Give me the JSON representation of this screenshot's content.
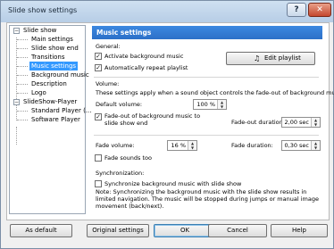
{
  "window": {
    "title": "Slide show settings",
    "help_glyph": "?",
    "close_glyph": "✕"
  },
  "tree": {
    "items": [
      {
        "label": "Slide show",
        "level": 0,
        "toggle": "−"
      },
      {
        "label": "Main settings",
        "level": 1
      },
      {
        "label": "Slide show end",
        "level": 1
      },
      {
        "label": "Transitions",
        "level": 1
      },
      {
        "label": "Music settings",
        "level": 1,
        "selected": true
      },
      {
        "label": "Background music",
        "level": 1
      },
      {
        "label": "Description",
        "level": 1
      },
      {
        "label": "Logo",
        "level": 1
      },
      {
        "label": "SlideShow-Player",
        "level": 0,
        "toggle": "−"
      },
      {
        "label": "Standard Player (...",
        "level": 1
      },
      {
        "label": "Software Player",
        "level": 1
      }
    ]
  },
  "panel": {
    "title": "Music settings",
    "general": {
      "heading": "General:",
      "activate_bg_music": "Activate background music",
      "activate_checked": true,
      "repeat_playlist": "Automatically repeat playlist",
      "repeat_checked": true,
      "edit_playlist": "Edit playlist",
      "edit_icon": "music-note-icon"
    },
    "volume": {
      "heading": "Volume:",
      "description": "These settings apply when a sound object controls the fade-out of background music.",
      "default_volume_label": "Default volume:",
      "default_volume_value": "100 %",
      "fadeout_label": "Fade-out of background music to slide show end",
      "fadeout_checked": true,
      "fadeout_duration_label": "Fade-out duration:",
      "fadeout_duration_value": "2,00 sec",
      "fade_volume_label": "Fade volume:",
      "fade_volume_value": "16 %",
      "fade_duration_label": "Fade duration:",
      "fade_duration_value": "0,30 sec",
      "fade_sounds_too": "Fade sounds too",
      "fade_sounds_checked": false
    },
    "sync": {
      "heading": "Synchronization:",
      "sync_label": "Synchronize background music with slide show",
      "sync_checked": false,
      "note": "Note: Synchronizing the background music with the slide show results in limited navigation. The music will be stopped during jumps or manual image movement (back/next)."
    }
  },
  "buttons": {
    "as_default": "As default",
    "original_settings": "Original settings",
    "ok": "OK",
    "cancel": "Cancel",
    "help": "Help"
  },
  "colors": {
    "accent": "#2c70c8",
    "selection": "#3399ff"
  }
}
